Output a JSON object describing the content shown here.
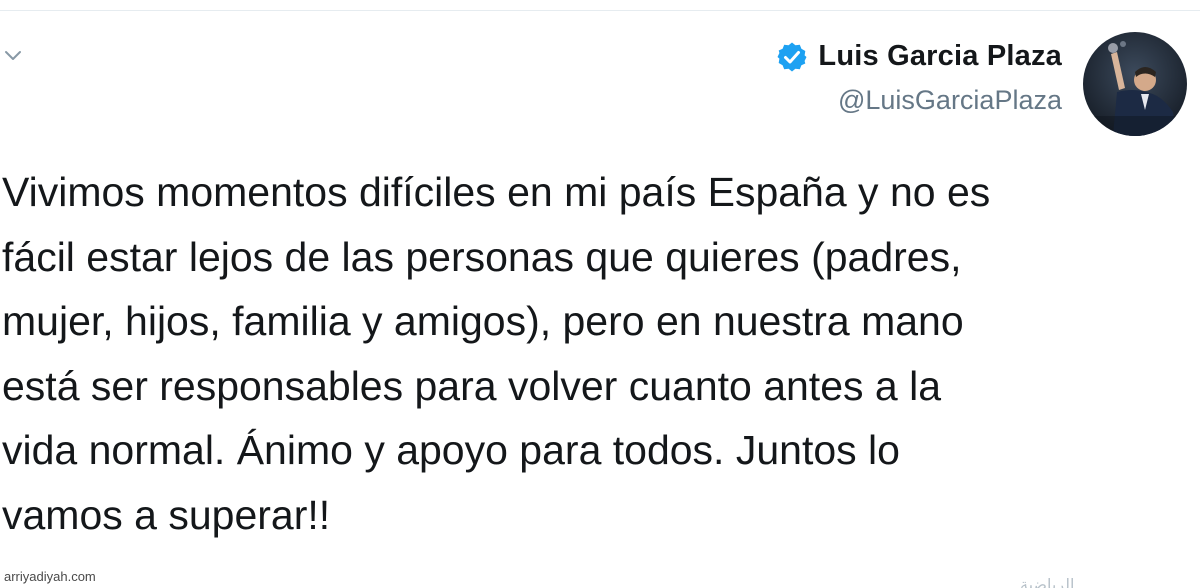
{
  "tweet": {
    "author": {
      "display_name": "Luis Garcia Plaza",
      "handle": "@LuisGarciaPlaza",
      "verified": true,
      "verified_color": "#1da1f2"
    },
    "text": "Vivimos momentos difíciles en mi país España y no es\nfácil estar lejos de las personas que quieres (padres,\nmujer, hijos, familia y amigos), pero en nuestra mano\nestá ser responsables para volver cuanto antes a la\nvida normal. Ánimo y apoyo para todos. Juntos lo\nvamos a superar!!",
    "menu_icon": "chevron-down-icon"
  },
  "watermark": "arriyadiyah.com",
  "footer_text": "الرياضية"
}
